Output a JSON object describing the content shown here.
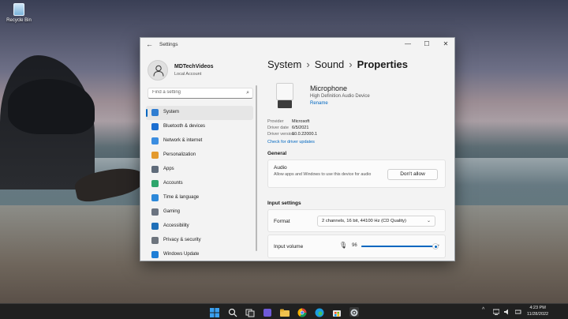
{
  "desktop": {
    "icon_label": "Recycle Bin"
  },
  "window": {
    "title": "Settings",
    "controls": {
      "minimize": "—",
      "maximize": "☐",
      "close": "✕"
    }
  },
  "profile": {
    "name": "MDTechVideos",
    "account": "Local Account"
  },
  "search": {
    "placeholder": "Find a setting"
  },
  "nav": {
    "items": [
      {
        "label": "System",
        "icon": "system-icon",
        "color": "#2f7dd1",
        "active": true
      },
      {
        "label": "Bluetooth & devices",
        "icon": "bluetooth-icon",
        "color": "#1c6fd1"
      },
      {
        "label": "Network & internet",
        "icon": "network-icon",
        "color": "#3b8de0"
      },
      {
        "label": "Personalization",
        "icon": "brush-icon",
        "color": "#e39a2e"
      },
      {
        "label": "Apps",
        "icon": "apps-icon",
        "color": "#5f6b7a"
      },
      {
        "label": "Accounts",
        "icon": "accounts-icon",
        "color": "#2ea56b"
      },
      {
        "label": "Time & language",
        "icon": "globe-clock-icon",
        "color": "#2c88d9"
      },
      {
        "label": "Gaming",
        "icon": "gamepad-icon",
        "color": "#6b7380"
      },
      {
        "label": "Accessibility",
        "icon": "accessibility-icon",
        "color": "#1f6fb8"
      },
      {
        "label": "Privacy & security",
        "icon": "shield-icon",
        "color": "#6d747d"
      },
      {
        "label": "Windows Update",
        "icon": "update-icon",
        "color": "#1f7ed6"
      }
    ]
  },
  "breadcrumb": {
    "part1": "System",
    "part2": "Sound",
    "current": "Properties",
    "separator": "›"
  },
  "device": {
    "name": "Microphone",
    "subtitle": "High Definition Audio Device",
    "rename": "Rename"
  },
  "driver": {
    "rows": [
      {
        "key": "Provider",
        "value": "Microsoft"
      },
      {
        "key": "Driver date",
        "value": "6/5/2021"
      },
      {
        "key": "Driver version",
        "value": "10.0.22000.1"
      }
    ],
    "check_link": "Check for driver updates"
  },
  "general": {
    "heading": "General",
    "audio_label": "Audio",
    "audio_desc": "Allow apps and Windows to use this device for audio",
    "button": "Don't allow"
  },
  "input_settings": {
    "heading": "Input settings",
    "format_label": "Format",
    "format_value": "2 channels, 16 bit, 44100 Hz (CD Quality)",
    "volume_label": "Input volume",
    "volume_value": "96",
    "volume_level": 0.96
  },
  "taskbar": {
    "tray_chevron": "^",
    "time": "4:23 PM",
    "date": "11/28/2022"
  }
}
